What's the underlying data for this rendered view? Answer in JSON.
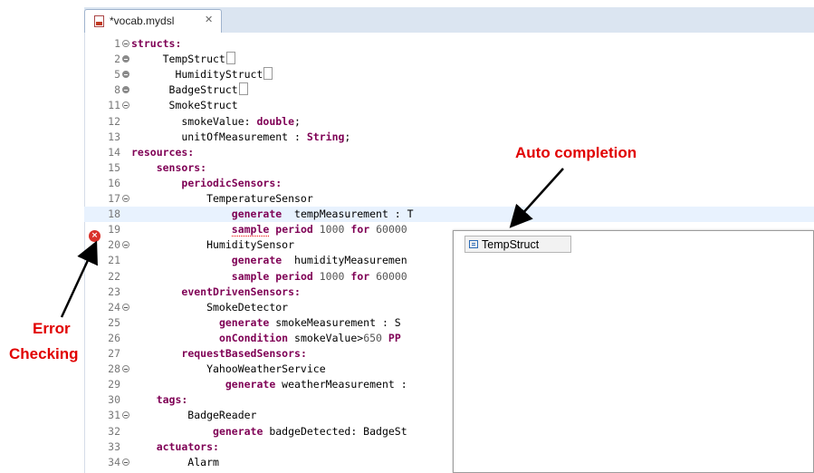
{
  "tab": {
    "title": "*vocab.mydsl",
    "close": "✕"
  },
  "editor": {
    "lines": [
      {
        "n": "1",
        "fold": "expanded",
        "tokens": [
          {
            "t": "structs:",
            "c": "kw"
          }
        ]
      },
      {
        "n": "2",
        "fold": "collapsed",
        "tokens": [
          {
            "t": "     TempStruct"
          },
          {
            "t": "",
            "c": "box"
          }
        ]
      },
      {
        "n": "5",
        "fold": "collapsed",
        "tokens": [
          {
            "t": "       HumidityStruct"
          },
          {
            "t": "",
            "c": "box"
          }
        ]
      },
      {
        "n": "8",
        "fold": "collapsed",
        "tokens": [
          {
            "t": "      BadgeStruct"
          },
          {
            "t": "",
            "c": "box"
          }
        ]
      },
      {
        "n": "11",
        "fold": "expanded",
        "tokens": [
          {
            "t": "      SmokeStruct"
          }
        ]
      },
      {
        "n": "12",
        "fold": "",
        "tokens": [
          {
            "t": "        smokeValue: "
          },
          {
            "t": "double",
            "c": "kw"
          },
          {
            "t": ";"
          }
        ]
      },
      {
        "n": "13",
        "fold": "",
        "tokens": [
          {
            "t": "        unitOfMeasurement : "
          },
          {
            "t": "String",
            "c": "kw"
          },
          {
            "t": ";"
          }
        ]
      },
      {
        "n": "14",
        "fold": "",
        "tokens": [
          {
            "t": "resources:",
            "c": "kw"
          }
        ]
      },
      {
        "n": "15",
        "fold": "",
        "tokens": [
          {
            "t": "    "
          },
          {
            "t": "sensors:",
            "c": "kw"
          }
        ]
      },
      {
        "n": "16",
        "fold": "",
        "tokens": [
          {
            "t": "        "
          },
          {
            "t": "periodicSensors:",
            "c": "kw"
          }
        ]
      },
      {
        "n": "17",
        "fold": "expanded",
        "tokens": [
          {
            "t": "            TemperatureSensor"
          }
        ]
      },
      {
        "n": "18",
        "fold": "",
        "current": true,
        "tokens": [
          {
            "t": "                "
          },
          {
            "t": "generate",
            "c": "kw"
          },
          {
            "t": "  tempMeasurement : T"
          }
        ]
      },
      {
        "n": "19",
        "fold": "",
        "error": true,
        "tokens": [
          {
            "t": "                "
          },
          {
            "t": "sample",
            "c": "kw sq"
          },
          {
            "t": " "
          },
          {
            "t": "period",
            "c": "kw"
          },
          {
            "t": " "
          },
          {
            "t": "1000",
            "c": "num"
          },
          {
            "t": " "
          },
          {
            "t": "for",
            "c": "kw"
          },
          {
            "t": " "
          },
          {
            "t": "60000",
            "c": "num"
          }
        ]
      },
      {
        "n": "20",
        "fold": "expanded",
        "tokens": [
          {
            "t": "            HumiditySensor"
          }
        ]
      },
      {
        "n": "21",
        "fold": "",
        "tokens": [
          {
            "t": "                "
          },
          {
            "t": "generate",
            "c": "kw"
          },
          {
            "t": "  humidityMeasuremen"
          }
        ]
      },
      {
        "n": "22",
        "fold": "",
        "tokens": [
          {
            "t": "                "
          },
          {
            "t": "sample",
            "c": "kw"
          },
          {
            "t": " "
          },
          {
            "t": "period",
            "c": "kw"
          },
          {
            "t": " "
          },
          {
            "t": "1000",
            "c": "num"
          },
          {
            "t": " "
          },
          {
            "t": "for",
            "c": "kw"
          },
          {
            "t": " "
          },
          {
            "t": "60000",
            "c": "num"
          }
        ]
      },
      {
        "n": "23",
        "fold": "",
        "tokens": [
          {
            "t": "        "
          },
          {
            "t": "eventDrivenSensors:",
            "c": "kw"
          }
        ]
      },
      {
        "n": "24",
        "fold": "expanded",
        "tokens": [
          {
            "t": "            SmokeDetector"
          }
        ]
      },
      {
        "n": "25",
        "fold": "",
        "tokens": [
          {
            "t": "              "
          },
          {
            "t": "generate",
            "c": "kw"
          },
          {
            "t": " smokeMeasurement : S"
          }
        ]
      },
      {
        "n": "26",
        "fold": "",
        "tokens": [
          {
            "t": "              "
          },
          {
            "t": "onCondition",
            "c": "kw"
          },
          {
            "t": " smokeValue>"
          },
          {
            "t": "650",
            "c": "num"
          },
          {
            "t": " "
          },
          {
            "t": "PP",
            "c": "kw"
          }
        ]
      },
      {
        "n": "27",
        "fold": "",
        "tokens": [
          {
            "t": "        "
          },
          {
            "t": "requestBasedSensors:",
            "c": "kw"
          }
        ]
      },
      {
        "n": "28",
        "fold": "expanded",
        "tokens": [
          {
            "t": "            YahooWeatherService"
          }
        ]
      },
      {
        "n": "29",
        "fold": "",
        "tokens": [
          {
            "t": "               "
          },
          {
            "t": "generate",
            "c": "kw"
          },
          {
            "t": " weatherMeasurement :"
          }
        ]
      },
      {
        "n": "30",
        "fold": "",
        "tokens": [
          {
            "t": "    "
          },
          {
            "t": "tags:",
            "c": "kw"
          }
        ]
      },
      {
        "n": "31",
        "fold": "expanded",
        "tokens": [
          {
            "t": "         BadgeReader"
          }
        ]
      },
      {
        "n": "32",
        "fold": "",
        "tokens": [
          {
            "t": "             "
          },
          {
            "t": "generate",
            "c": "kw"
          },
          {
            "t": " badgeDetected: BadgeSt"
          }
        ]
      },
      {
        "n": "33",
        "fold": "",
        "tokens": [
          {
            "t": "    "
          },
          {
            "t": "actuators:",
            "c": "kw"
          }
        ]
      },
      {
        "n": "34",
        "fold": "expanded",
        "tokens": [
          {
            "t": "         Alarm"
          }
        ]
      }
    ]
  },
  "error_marker": {
    "icon": "error-icon",
    "symbol": "×"
  },
  "autocomplete": {
    "items": [
      {
        "label": "TempStruct",
        "icon": "struct-icon"
      }
    ]
  },
  "annotations": {
    "auto_completion": "Auto completion",
    "error_line1": "Error",
    "error_line2": "Checking"
  },
  "colors": {
    "annotation": "#e10000",
    "keyword": "#7f0055",
    "current_line": "#e8f2fe",
    "error": "#d9312a"
  }
}
